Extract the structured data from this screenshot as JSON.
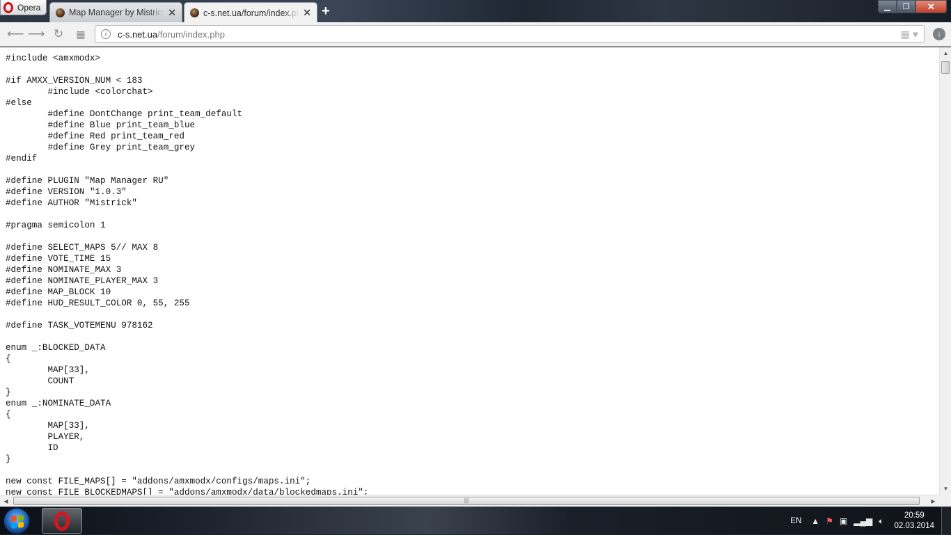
{
  "browser": {
    "menu_label": "Opera",
    "tabs": [
      {
        "title": "Map Manager by Mistrick",
        "active": false
      },
      {
        "title": "c-s.net.ua/forum/index.php",
        "active": true
      }
    ],
    "new_tab_glyph": "+",
    "close_glyph": "✕",
    "address": {
      "host": "c-s.net.ua",
      "path": "/forum/index.php"
    }
  },
  "code_lines": [
    "#include <amxmodx>",
    "",
    "#if AMXX_VERSION_NUM < 183",
    "        #include <colorchat>",
    "#else",
    "        #define DontChange print_team_default",
    "        #define Blue print_team_blue",
    "        #define Red print_team_red",
    "        #define Grey print_team_grey",
    "#endif",
    "",
    "#define PLUGIN \"Map Manager RU\"",
    "#define VERSION \"1.0.3\"",
    "#define AUTHOR \"Mistrick\"",
    "",
    "#pragma semicolon 1",
    "",
    "#define SELECT_MAPS 5// MAX 8",
    "#define VOTE_TIME 15",
    "#define NOMINATE_MAX 3",
    "#define NOMINATE_PLAYER_MAX 3",
    "#define MAP_BLOCK 10",
    "#define HUD_RESULT_COLOR 0, 55, 255",
    "",
    "#define TASK_VOTEMENU 978162",
    "",
    "enum _:BLOCKED_DATA",
    "{",
    "        MAP[33],",
    "        COUNT",
    "}",
    "enum _:NOMINATE_DATA",
    "{",
    "        MAP[33],",
    "        PLAYER,",
    "        ID",
    "}",
    "",
    "new const FILE_MAPS[] = \"addons/amxmodx/configs/maps.ini\";",
    "new const FILE_BLOCKEDMAPS[] = \"addons/amxmodx/data/blockedmaps.ini\";"
  ],
  "taskbar": {
    "language": "EN",
    "time": "20:59",
    "date": "02.03.2014"
  },
  "colors": {
    "opera_red": "#cc0f16",
    "code_text": "#111111"
  }
}
